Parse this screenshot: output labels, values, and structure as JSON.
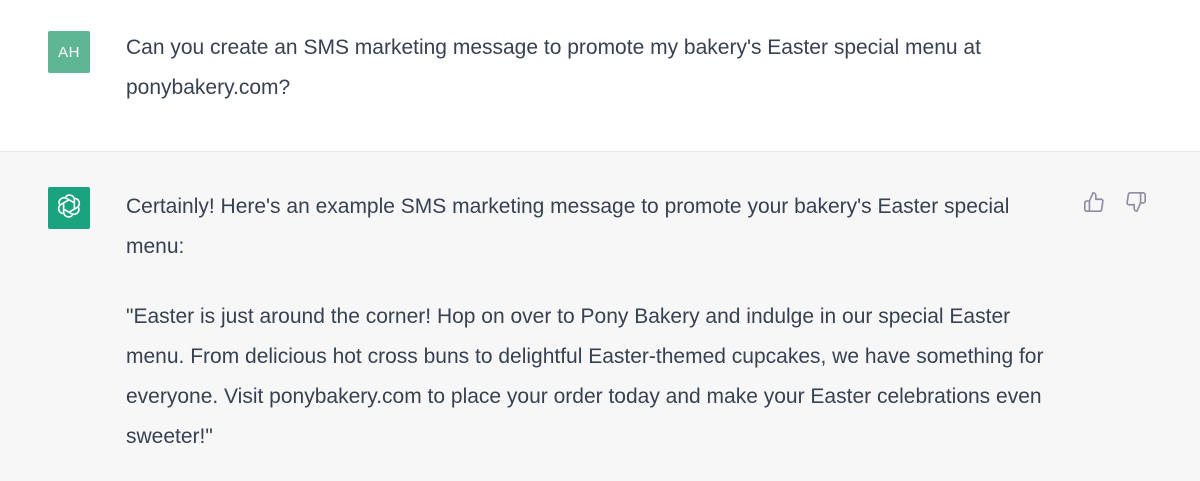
{
  "user_message": {
    "avatar_initials": "AH",
    "avatar_color": "#5fb694",
    "text": "Can you create an SMS marketing message to promote my bakery's Easter special menu at ponybakery.com?"
  },
  "assistant_message": {
    "avatar_icon": "openai-logo-icon",
    "avatar_color": "#19a37f",
    "paragraphs": [
      "Certainly! Here's an example SMS marketing message to promote your bakery's Easter special menu:",
      "\"Easter is just around the corner! Hop on over to Pony Bakery and indulge in our special Easter menu. From delicious hot cross buns to delightful Easter-themed cupcakes, we have something for everyone. Visit ponybakery.com to place your order today and make your Easter celebrations even sweeter!\""
    ],
    "feedback_icons": [
      "thumbs-up-icon",
      "thumbs-down-icon"
    ]
  },
  "colors": {
    "assistant_background": "#f7f7f8",
    "text": "#374151",
    "icon": "#8e8ea0"
  }
}
